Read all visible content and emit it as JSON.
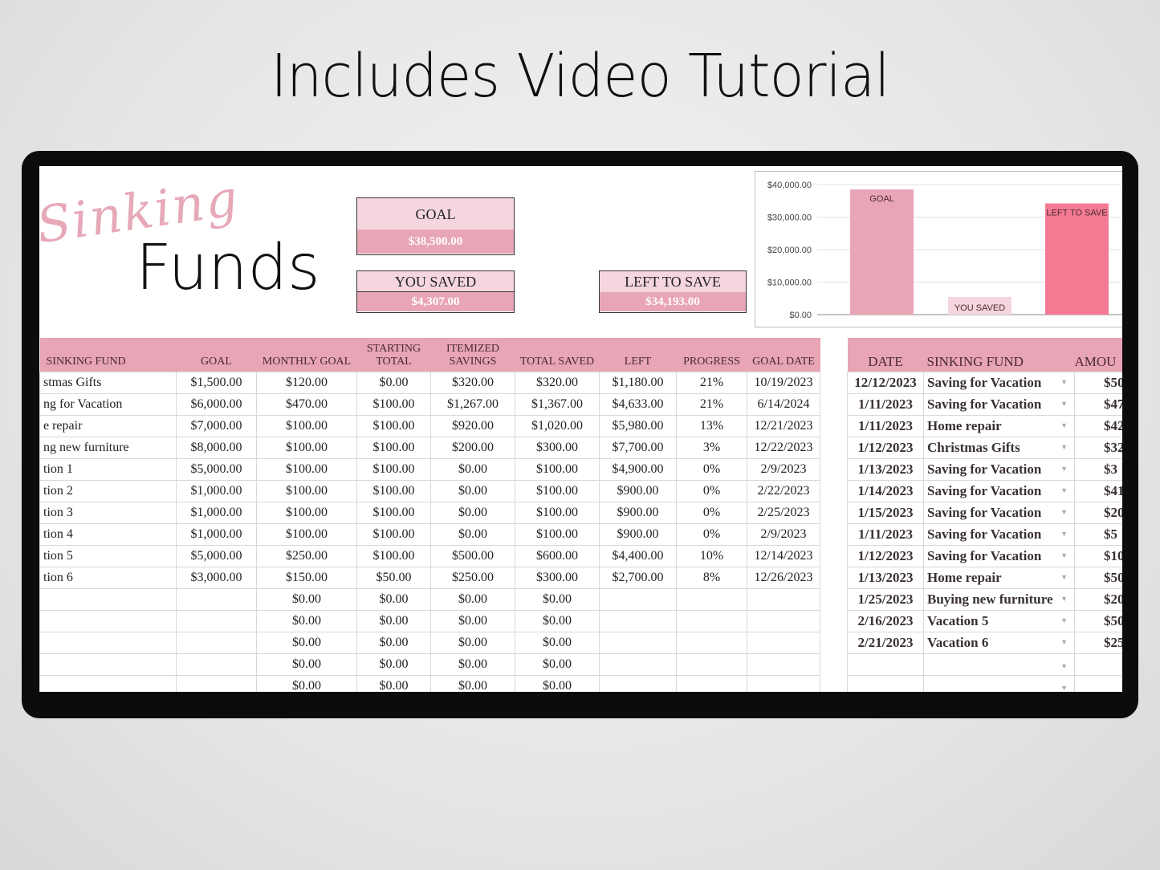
{
  "headline": "Includes Video Tutorial",
  "logo": {
    "script": "Sinking",
    "main": "Funds"
  },
  "summary": {
    "goal_label": "GOAL",
    "goal_value": "$38,500.00",
    "saved_label": "YOU SAVED",
    "saved_value": "$4,307.00",
    "left_label": "LEFT TO SAVE",
    "left_value": "$34,193.00"
  },
  "colors": {
    "header_pink": "#e8a5b5",
    "light_pink": "#f5d6de",
    "goal_bar": "#e8a5b5",
    "saved_bar": "#f5d6de",
    "left_bar": "#f47a94"
  },
  "chart_data": {
    "type": "bar",
    "categories": [
      "GOAL",
      "YOU SAVED",
      "LEFT TO SAVE"
    ],
    "values": [
      38500,
      4307,
      34193
    ],
    "ylim": [
      0,
      40000
    ],
    "yticks": [
      "$0.00",
      "$10,000.00",
      "$20,000.00",
      "$30,000.00",
      "$40,000.00"
    ],
    "grid": true,
    "data_labels": [
      "GOAL",
      "YOU SAVED",
      "LEFT TO SAVE"
    ]
  },
  "main_table": {
    "headers": [
      "SINKING FUND",
      "GOAL",
      "MONTHLY GOAL",
      "STARTING TOTAL",
      "ITEMIZED SAVINGS",
      "TOTAL SAVED",
      "LEFT",
      "PROGRESS",
      "GOAL DATE"
    ],
    "rows": [
      [
        "stmas Gifts",
        "$1,500.00",
        "$120.00",
        "$0.00",
        "$320.00",
        "$320.00",
        "$1,180.00",
        "21%",
        "10/19/2023"
      ],
      [
        "ng for Vacation",
        "$6,000.00",
        "$470.00",
        "$100.00",
        "$1,267.00",
        "$1,367.00",
        "$4,633.00",
        "21%",
        "6/14/2024"
      ],
      [
        "e repair",
        "$7,000.00",
        "$100.00",
        "$100.00",
        "$920.00",
        "$1,020.00",
        "$5,980.00",
        "13%",
        "12/21/2023"
      ],
      [
        "ng new furniture",
        "$8,000.00",
        "$100.00",
        "$100.00",
        "$200.00",
        "$300.00",
        "$7,700.00",
        "3%",
        "12/22/2023"
      ],
      [
        "tion 1",
        "$5,000.00",
        "$100.00",
        "$100.00",
        "$0.00",
        "$100.00",
        "$4,900.00",
        "0%",
        "2/9/2023"
      ],
      [
        "tion 2",
        "$1,000.00",
        "$100.00",
        "$100.00",
        "$0.00",
        "$100.00",
        "$900.00",
        "0%",
        "2/22/2023"
      ],
      [
        "tion 3",
        "$1,000.00",
        "$100.00",
        "$100.00",
        "$0.00",
        "$100.00",
        "$900.00",
        "0%",
        "2/25/2023"
      ],
      [
        "tion 4",
        "$1,000.00",
        "$100.00",
        "$100.00",
        "$0.00",
        "$100.00",
        "$900.00",
        "0%",
        "2/9/2023"
      ],
      [
        "tion 5",
        "$5,000.00",
        "$250.00",
        "$100.00",
        "$500.00",
        "$600.00",
        "$4,400.00",
        "10%",
        "12/14/2023"
      ],
      [
        "tion 6",
        "$3,000.00",
        "$150.00",
        "$50.00",
        "$250.00",
        "$300.00",
        "$2,700.00",
        "8%",
        "12/26/2023"
      ],
      [
        "",
        "",
        "$0.00",
        "$0.00",
        "$0.00",
        "$0.00",
        "",
        "",
        ""
      ],
      [
        "",
        "",
        "$0.00",
        "$0.00",
        "$0.00",
        "$0.00",
        "",
        "",
        ""
      ],
      [
        "",
        "",
        "$0.00",
        "$0.00",
        "$0.00",
        "$0.00",
        "",
        "",
        ""
      ],
      [
        "",
        "",
        "$0.00",
        "$0.00",
        "$0.00",
        "$0.00",
        "",
        "",
        ""
      ],
      [
        "",
        "",
        "$0.00",
        "$0.00",
        "$0.00",
        "$0.00",
        "",
        "",
        ""
      ]
    ]
  },
  "log_table": {
    "headers": [
      "DATE",
      "SINKING FUND",
      "AMOU"
    ],
    "rows": [
      [
        "12/12/2023",
        "Saving for Vacation",
        "$50"
      ],
      [
        "1/11/2023",
        "Saving for Vacation",
        "$47"
      ],
      [
        "1/11/2023",
        "Home repair",
        "$42"
      ],
      [
        "1/12/2023",
        "Christmas Gifts",
        "$32"
      ],
      [
        "1/13/2023",
        "Saving for Vacation",
        "$3"
      ],
      [
        "1/14/2023",
        "Saving for Vacation",
        "$41"
      ],
      [
        "1/15/2023",
        "Saving for Vacation",
        "$20"
      ],
      [
        "1/11/2023",
        "Saving for Vacation",
        "$5"
      ],
      [
        "1/12/2023",
        "Saving for Vacation",
        "$10"
      ],
      [
        "1/13/2023",
        "Home repair",
        "$50"
      ],
      [
        "1/25/2023",
        "Buying new furniture",
        "$20"
      ],
      [
        "2/16/2023",
        "Vacation 5",
        "$50"
      ],
      [
        "2/21/2023",
        "Vacation 6",
        "$25"
      ],
      [
        "",
        "",
        ""
      ],
      [
        "",
        "",
        ""
      ]
    ]
  }
}
